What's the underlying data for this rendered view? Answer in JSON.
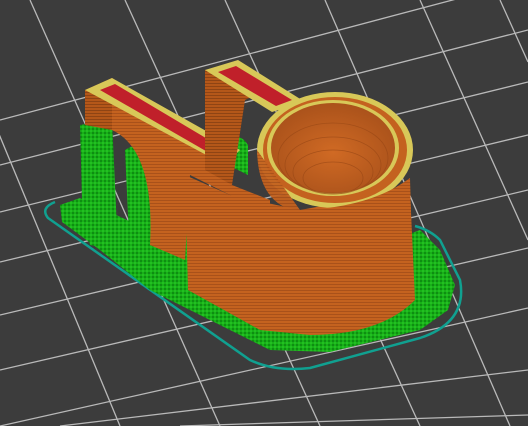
{
  "viewport": {
    "view": "3d-preview",
    "background_color": "#3c3c3c",
    "grid_color": "#d0d0d0",
    "colors": {
      "perimeter": "#c4621f",
      "perimeter_dark": "#a9511a",
      "top_solid_infill": "#c0202a",
      "support": "#18b018",
      "support_dark": "#0c8a10",
      "skirt_brim": "#10a090",
      "external_perimeter_edge": "#d8c858"
    },
    "icons": [
      "print-bed-grid",
      "skirt-outline",
      "support-material",
      "model-part"
    ]
  }
}
